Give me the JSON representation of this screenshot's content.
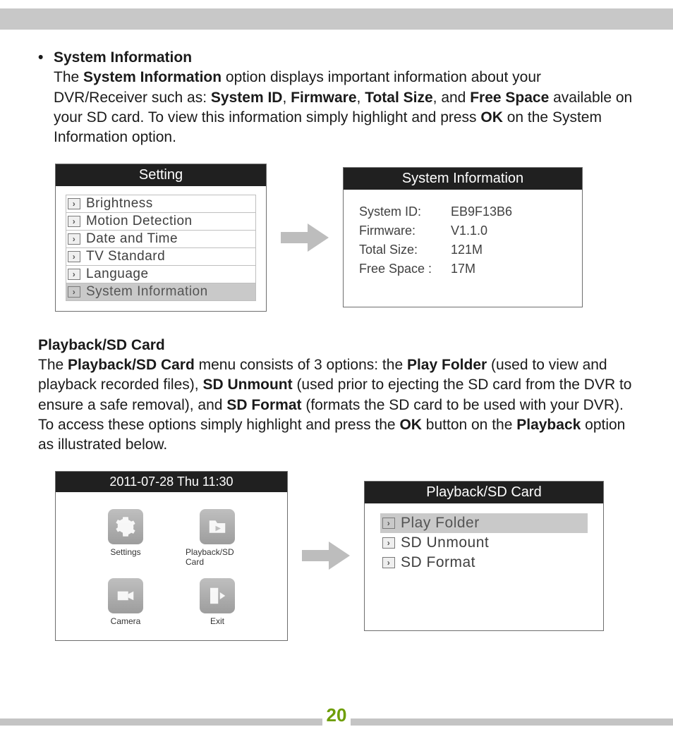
{
  "section1": {
    "bullet": "•",
    "title": "System Information",
    "p_1": "The ",
    "p_2": "System Information",
    "p_3": " option displays important information about your DVR/Receiver such as: ",
    "p_4": "System ID",
    "p_5": ", ",
    "p_6": "Firmware",
    "p_7": ", ",
    "p_8": "Total Size",
    "p_9": ", and ",
    "p_10": "Free Space",
    "p_11": " available on your SD card. To view this information simply highlight and press ",
    "p_12": "OK",
    "p_13": " on the System Information option."
  },
  "settings_menu": {
    "header": "Setting",
    "items": [
      "Brightness",
      "Motion Detection",
      "Date and Time",
      "TV Standard",
      "Language",
      "System Information"
    ]
  },
  "sysinfo_panel": {
    "header": "System Information",
    "rows": [
      {
        "label": "System ID:",
        "value": "EB9F13B6"
      },
      {
        "label": "Firmware:",
        "value": "V1.1.0"
      },
      {
        "label": "Total Size:",
        "value": "121M"
      },
      {
        "label": "Free Space :",
        "value": "17M"
      }
    ]
  },
  "section2": {
    "title": "Playback/SD Card",
    "q_1": "The ",
    "q_2": "Playback/SD Card",
    "q_3": " menu consists of 3 options: the ",
    "q_4": "Play Folder",
    "q_5": " (used to view and playback recorded files), ",
    "q_6": "SD Unmount",
    "q_7": " (used prior to ejecting the SD card from the DVR to ensure a safe removal), and ",
    "q_8": "SD Format",
    "q_9": " (formats the SD card to be used with your DVR). To access these options simply highlight and press the ",
    "q_10": "OK",
    "q_11": " button on the ",
    "q_12": "Playback",
    "q_13": " option as illustrated below."
  },
  "home_menu": {
    "datetime": "2011-07-28 Thu  11:30",
    "tiles": [
      {
        "label": "Settings",
        "icon": "gear-icon"
      },
      {
        "label": "Playback/SD Card",
        "icon": "folder-play-icon"
      },
      {
        "label": "Camera",
        "icon": "camera-icon"
      },
      {
        "label": "Exit",
        "icon": "exit-icon"
      }
    ]
  },
  "playback_menu": {
    "header": "Playback/SD Card",
    "items": [
      "Play Folder",
      "SD Unmount",
      "SD Format"
    ]
  },
  "page_number": "20"
}
